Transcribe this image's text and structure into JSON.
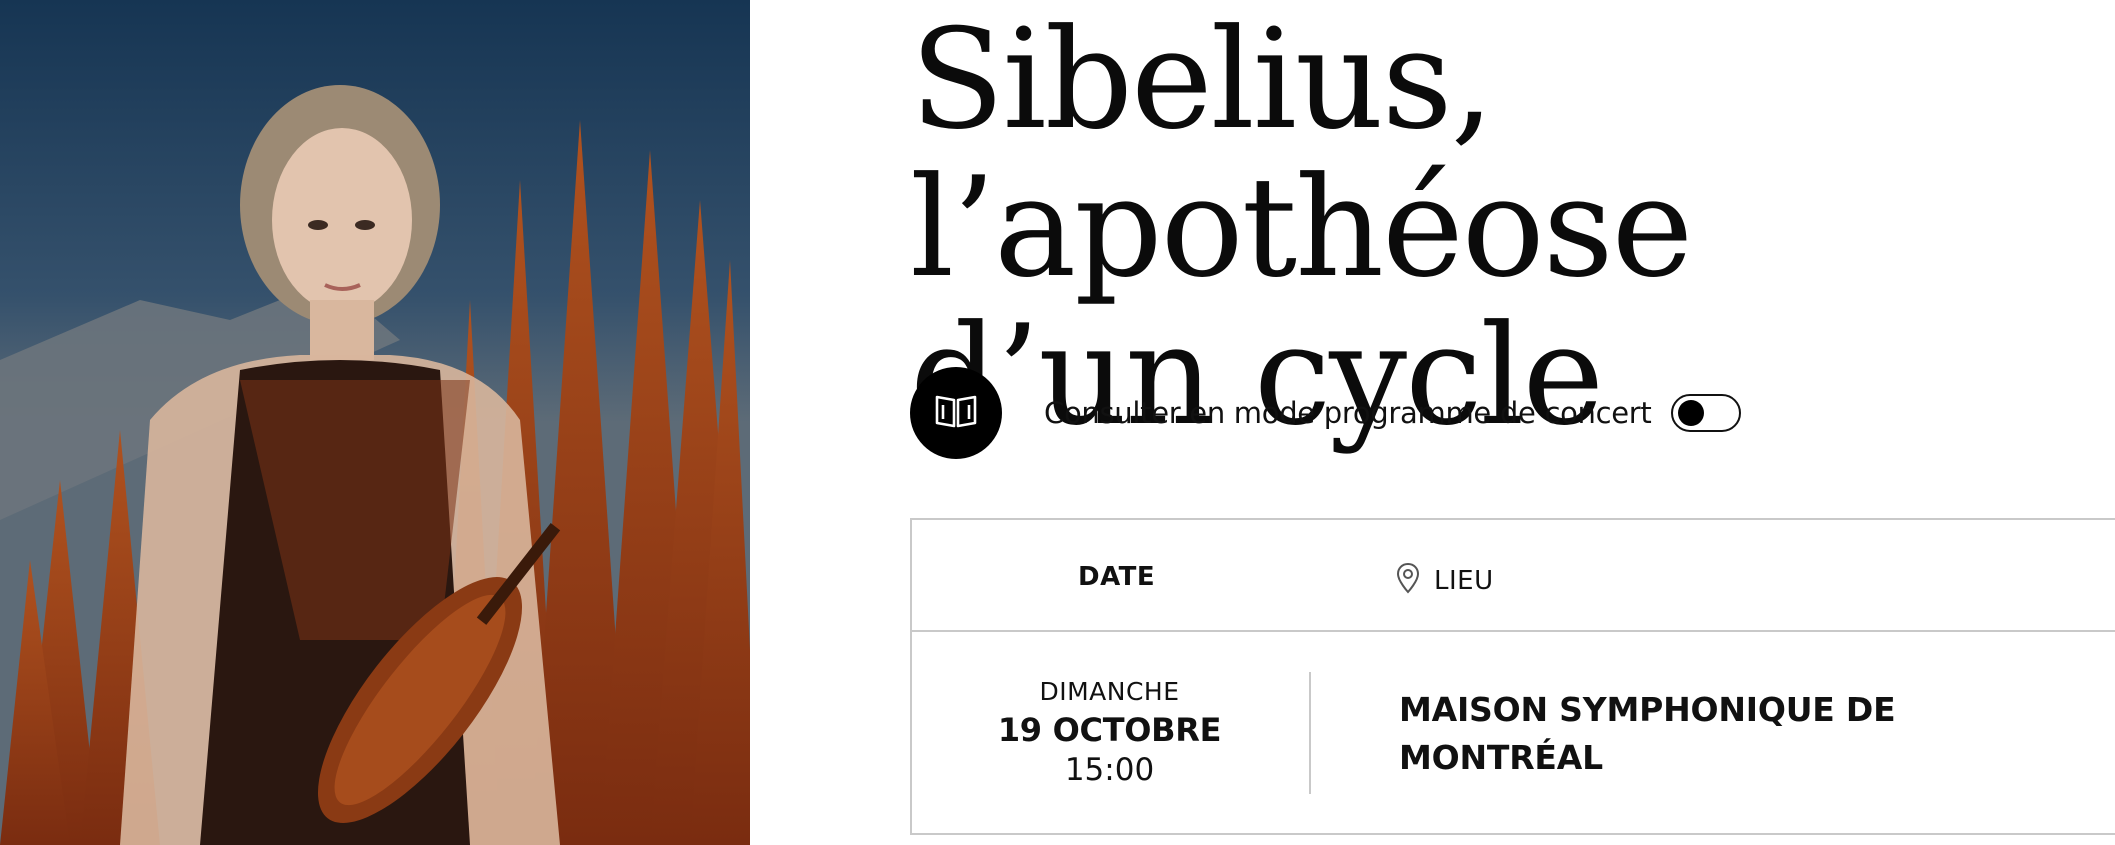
{
  "concert": {
    "title": "Sibelius, l’apothéose\nd’un cycle",
    "program_mode_label": "Consulter en mode programme de concert",
    "program_mode_enabled": false
  },
  "table": {
    "header_date": "DATE",
    "header_venue": "LIEU",
    "row": {
      "weekday": "DIMANCHE",
      "date": "19 OCTOBRE",
      "time": "15:00",
      "venue": "MAISON SYMPHONIQUE DE\nMONTRÉAL"
    }
  },
  "icons": {
    "program": "open-book-icon",
    "venue": "map-pin-icon"
  },
  "colors": {
    "text": "#0b0b0b",
    "border": "#c9c9c9",
    "accent": "#000000"
  }
}
